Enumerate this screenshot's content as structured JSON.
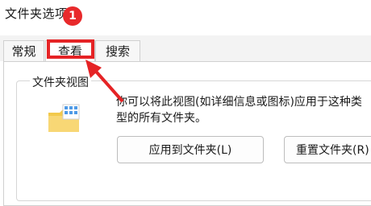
{
  "window": {
    "title": "文件夹选项",
    "step_badge": "1"
  },
  "tabs": [
    {
      "label": "常规"
    },
    {
      "label": "查看"
    },
    {
      "label": "搜索"
    }
  ],
  "folder_views": {
    "group_label": "文件夹视图",
    "description": "你可以将此视图(如详细信息或图标)应用于这种类型的所有文件夹。",
    "apply_button": "应用到文件夹(L)",
    "reset_button": "重置文件夹(R)"
  },
  "colors": {
    "annotation": "#e52325"
  },
  "icons": [
    "folder-view-icon",
    "annotation-arrow"
  ]
}
